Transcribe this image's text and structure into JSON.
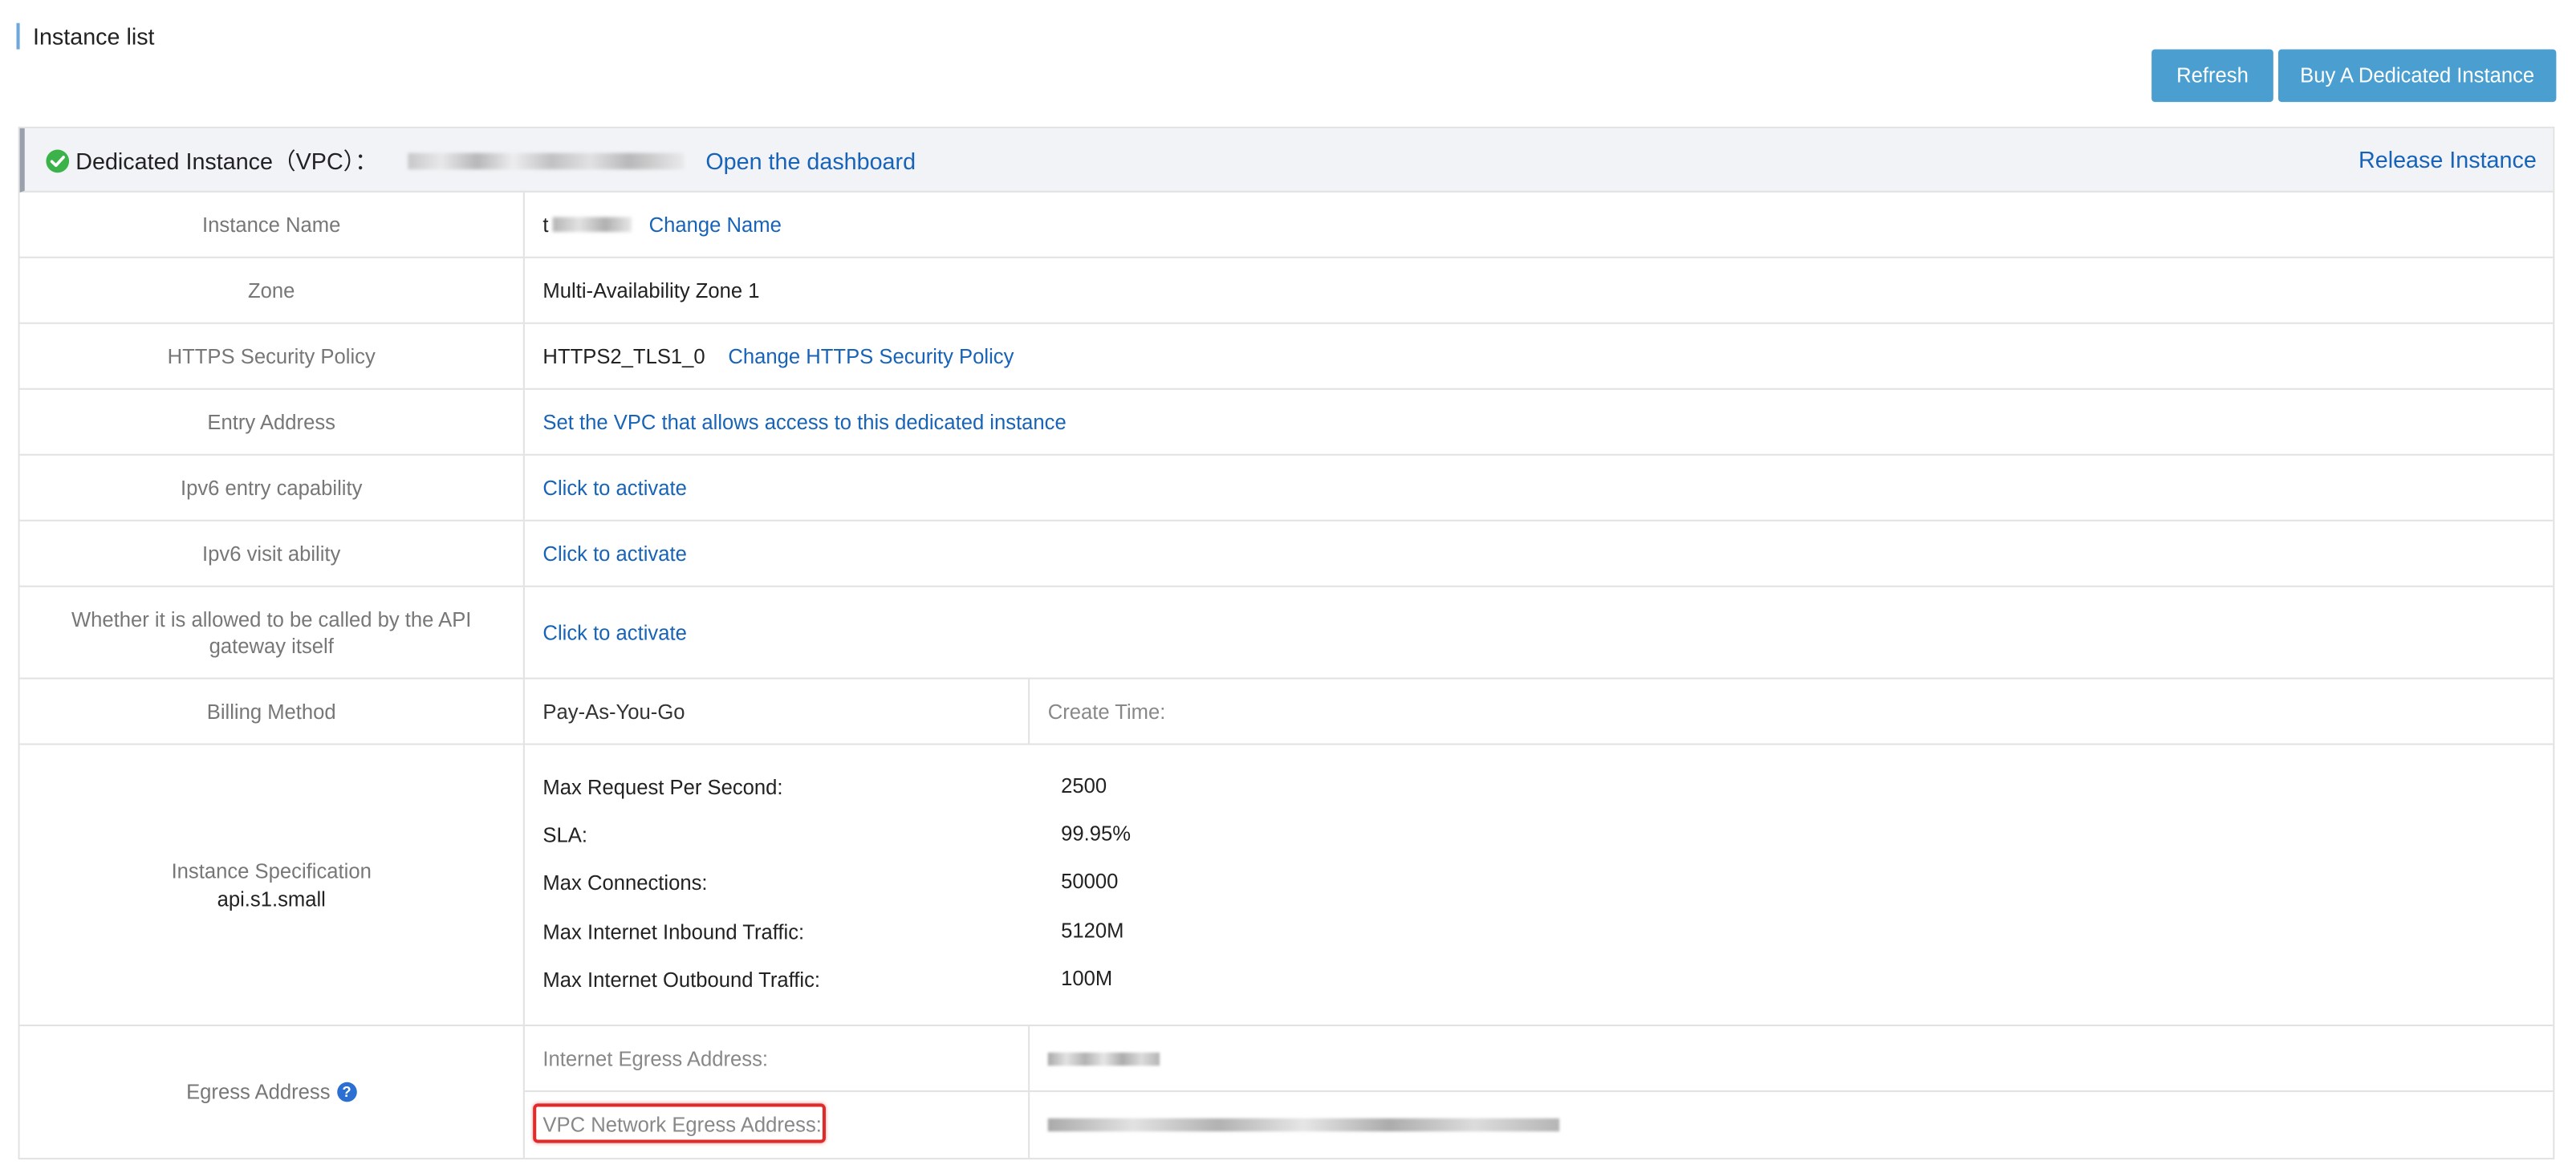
{
  "page": {
    "title": "Instance list"
  },
  "toolbar": {
    "refresh_label": "Refresh",
    "buy_label": "Buy A Dedicated Instance"
  },
  "panel": {
    "heading": "Dedicated Instance（VPC）：",
    "instance_id_blurred": "a",
    "open_dashboard": "Open the dashboard",
    "release": "Release Instance"
  },
  "rows": {
    "name": {
      "label": "Instance Name",
      "value_prefix": "t",
      "action": "Change Name"
    },
    "zone": {
      "label": "Zone",
      "value": "Multi-Availability Zone 1"
    },
    "https": {
      "label": "HTTPS Security Policy",
      "value": "HTTPS2_TLS1_0",
      "action": "Change HTTPS Security Policy"
    },
    "entry": {
      "label": "Entry Address",
      "action": "Set the VPC that allows access to this dedicated instance"
    },
    "ipv6_entry": {
      "label": "Ipv6 entry capability",
      "action": "Click to activate"
    },
    "ipv6_visit": {
      "label": "Ipv6 visit ability",
      "action": "Click to activate"
    },
    "self_call": {
      "label": "Whether it is allowed to be called by the API gateway itself",
      "action": "Click to activate"
    },
    "billing": {
      "label": "Billing Method",
      "value": "Pay-As-You-Go",
      "create_time_label": "Create Time:"
    },
    "spec": {
      "label": "Instance Specification",
      "type": "api.s1.small",
      "items": [
        {
          "k": "Max Request Per Second:",
          "v": "2500"
        },
        {
          "k": "SLA:",
          "v": "99.95%"
        },
        {
          "k": "Max Connections:",
          "v": "50000"
        },
        {
          "k": "Max Internet Inbound Traffic:",
          "v": "5120M"
        },
        {
          "k": "Max Internet Outbound Traffic:",
          "v": "100M"
        }
      ]
    },
    "egress": {
      "label": "Egress Address",
      "help_icon": "question-icon",
      "internet_label": "Internet Egress Address:",
      "vpc_label": "VPC Network Egress Address:"
    }
  },
  "colors": {
    "accent": "#4a9fd0",
    "link": "#1763b8",
    "success": "#3bb34a",
    "highlight": "#e02b2b"
  }
}
